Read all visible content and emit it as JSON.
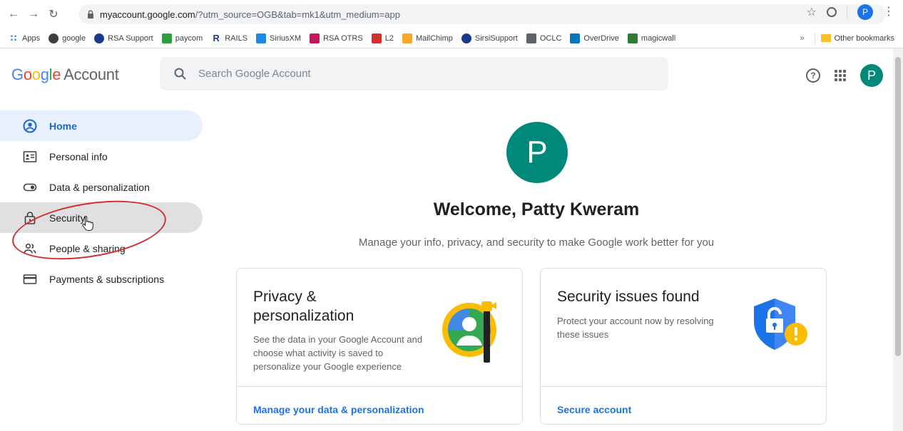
{
  "browser": {
    "url_host": "myaccount.google.com",
    "url_path": "/?utm_source=OGB&tab=mk1&utm_medium=app",
    "profile_initial": "P",
    "bookmarks": [
      {
        "label": "Apps",
        "icon": "apps-grid-icon",
        "color": "#4285f4"
      },
      {
        "label": "google",
        "icon": "globe-icon",
        "color": "#3c4043"
      },
      {
        "label": "RSA Support",
        "icon": "globe-icon",
        "color": "#1a3b8c"
      },
      {
        "label": "paycom",
        "icon": "paycom-icon",
        "color": "#2e9e3e"
      },
      {
        "label": "RAILS",
        "icon": "rails-r-icon",
        "color": "#1a3b8c"
      },
      {
        "label": "SiriusXM",
        "icon": "siriusxm-icon",
        "color": "#1e88e5"
      },
      {
        "label": "RSA OTRS",
        "icon": "otrs-icon",
        "color": "#c2185b"
      },
      {
        "label": "L2",
        "icon": "l2-icon",
        "color": "#d32f2f"
      },
      {
        "label": "MailChimp",
        "icon": "mailchimp-icon",
        "color": "#f9a825"
      },
      {
        "label": "SirsiSupport",
        "icon": "globe-icon",
        "color": "#1a3b8c"
      },
      {
        "label": "OCLC",
        "icon": "oclc-icon",
        "color": "#5f6368"
      },
      {
        "label": "OverDrive",
        "icon": "overdrive-icon",
        "color": "#0277bd"
      },
      {
        "label": "magicwall",
        "icon": "magicwall-icon",
        "color": "#2e7d32"
      }
    ],
    "bookmarks_overflow": "»",
    "other_bookmarks": "Other bookmarks"
  },
  "header": {
    "logo_google": [
      "G",
      "o",
      "o",
      "g",
      "l",
      "e"
    ],
    "logo_account": "Account",
    "search_placeholder": "Search Google Account",
    "avatar_initial": "P"
  },
  "sidebar": {
    "items": [
      {
        "label": "Home",
        "icon": "account-circle-icon"
      },
      {
        "label": "Personal info",
        "icon": "id-card-icon"
      },
      {
        "label": "Data & personalization",
        "icon": "toggle-icon"
      },
      {
        "label": "Security",
        "icon": "lock-icon"
      },
      {
        "label": "People & sharing",
        "icon": "people-icon"
      },
      {
        "label": "Payments & subscriptions",
        "icon": "credit-card-icon"
      }
    ]
  },
  "main": {
    "avatar_initial": "P",
    "welcome": "Welcome, Patty Kweram",
    "subtitle": "Manage your info, privacy, and security to make Google work better for you",
    "cards": [
      {
        "title": "Privacy & personalization",
        "description": "See the data in your Google Account and choose what activity is saved to personalize your Google experience",
        "link": "Manage your data & personalization"
      },
      {
        "title": "Security issues found",
        "description": "Protect your account now by resolving these issues",
        "link": "Secure account"
      }
    ]
  },
  "colors": {
    "accent_blue": "#1a73e8",
    "active_nav_bg": "#e8f0fe",
    "avatar_teal": "#00897b",
    "annotation_red": "#d32f2f",
    "warning_yellow": "#fbbc04"
  }
}
